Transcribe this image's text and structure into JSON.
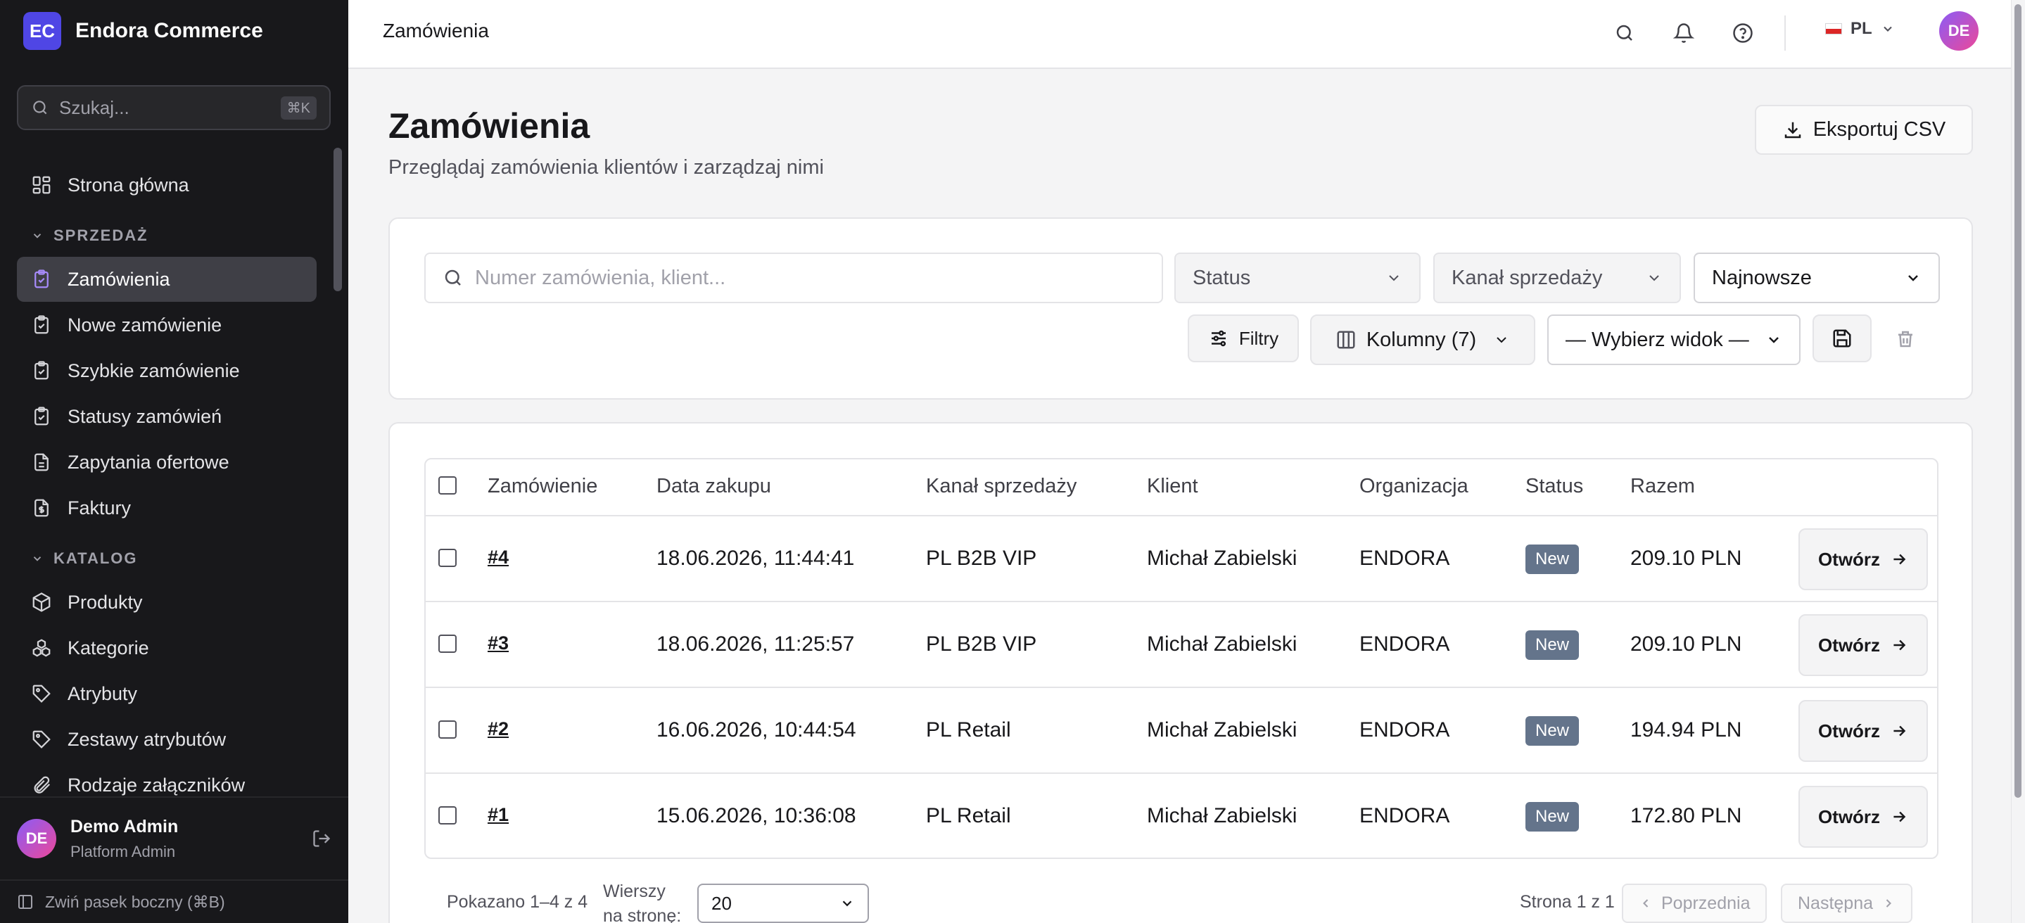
{
  "app": {
    "logo_initials": "EC",
    "name": "Endora Commerce"
  },
  "sidebar": {
    "search_placeholder": "Szukaj...",
    "search_shortcut": "⌘K",
    "home": "Strona główna",
    "sales_section": "SPRZEDAŻ",
    "sales_items": [
      "Zamówienia",
      "Nowe zamówienie",
      "Szybkie zamówienie",
      "Statusy zamówień",
      "Zapytania ofertowe",
      "Faktury"
    ],
    "catalog_section": "KATALOG",
    "catalog_items": [
      "Produkty",
      "Kategorie",
      "Atrybuty",
      "Zestawy atrybutów",
      "Rodzaje załączników"
    ],
    "user": {
      "initials": "DE",
      "name": "Demo Admin",
      "role": "Platform Admin"
    },
    "collapse_label": "Zwiń pasek boczny (⌘B)"
  },
  "topbar": {
    "title": "Zamówienia",
    "language": "PL",
    "avatar_initials": "DE"
  },
  "page": {
    "title": "Zamówienia",
    "subtitle": "Przeglądaj zamówienia klientów i zarządzaj nimi",
    "export_label": "Eksportuj CSV"
  },
  "filters": {
    "search_placeholder": "Numer zamówienia, klient...",
    "status": "Status",
    "channel": "Kanał sprzedaży",
    "sort": "Najnowsze",
    "filters_button": "Filtry",
    "columns_button": "Kolumny (7)",
    "view_select": "— Wybierz widok —"
  },
  "table": {
    "headers": [
      "Zamówienie",
      "Data zakupu",
      "Kanał sprzedaży",
      "Klient",
      "Organizacja",
      "Status",
      "Razem"
    ],
    "open_label": "Otwórz",
    "rows": [
      {
        "order": "#4",
        "date": "18.06.2026, 11:44:41",
        "channel": "PL B2B VIP",
        "client": "Michał Zabielski",
        "org": "ENDORA",
        "status": "New",
        "total": "209.10 PLN"
      },
      {
        "order": "#3",
        "date": "18.06.2026, 11:25:57",
        "channel": "PL B2B VIP",
        "client": "Michał Zabielski",
        "org": "ENDORA",
        "status": "New",
        "total": "209.10 PLN"
      },
      {
        "order": "#2",
        "date": "16.06.2026, 10:44:54",
        "channel": "PL Retail",
        "client": "Michał Zabielski",
        "org": "ENDORA",
        "status": "New",
        "total": "194.94 PLN"
      },
      {
        "order": "#1",
        "date": "15.06.2026, 10:36:08",
        "channel": "PL Retail",
        "client": "Michał Zabielski",
        "org": "ENDORA",
        "status": "New",
        "total": "172.80 PLN"
      }
    ]
  },
  "pagination": {
    "shown": "Pokazano 1–4 z 4",
    "rows_label_1": "Wierszy",
    "rows_label_2": "na stronę:",
    "rows_value": "20",
    "page": "Strona 1 z 1",
    "prev": "Poprzednia",
    "next": "Następna"
  },
  "colors": {
    "accent": "#4f46e5",
    "sidebar_bg": "#18181b",
    "badge": "#64748b"
  }
}
